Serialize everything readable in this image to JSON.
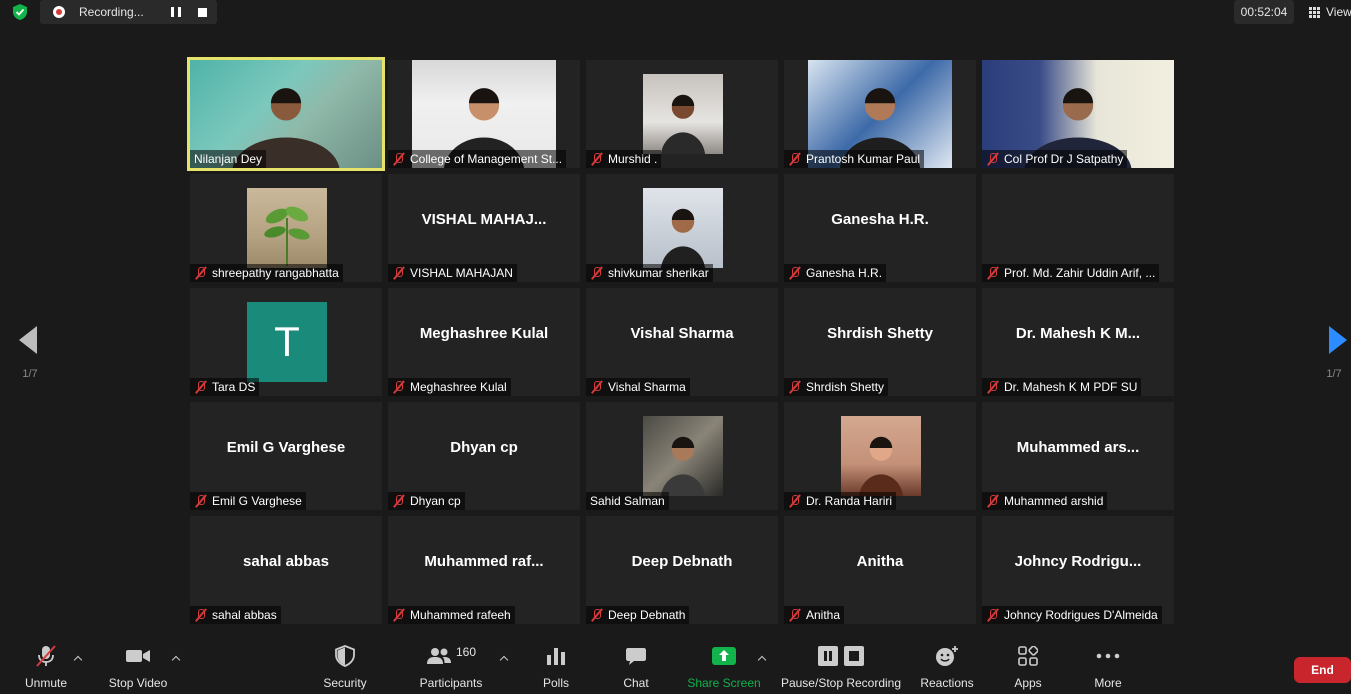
{
  "topbar": {
    "recording_label": "Recording...",
    "timer": "00:52:04",
    "view_label": "View"
  },
  "nav": {
    "left_page": "1/7",
    "right_page": "1/7"
  },
  "colors": {
    "accent": "#2d8cff",
    "active_speaker": "#e6e36a",
    "muted": "#d63b3b",
    "end": "#c9252d",
    "share": "#12b34b"
  },
  "tiles": [
    {
      "name": "Nilanjan Dey",
      "muted": false,
      "video": true
    },
    {
      "name": "College of Management St...",
      "muted": true,
      "video": true
    },
    {
      "name": "Murshid .",
      "muted": true,
      "video": true
    },
    {
      "name": "Prantosh Kumar Paul",
      "muted": true,
      "video": true
    },
    {
      "name": "Col Prof Dr J Satpathy",
      "muted": true,
      "video": true
    },
    {
      "name": "shreepathy rangabhatta",
      "muted": true,
      "video": true
    },
    {
      "name": "VISHAL MAHAJAN",
      "display": "VISHAL  MAHAJ...",
      "muted": true,
      "video": false
    },
    {
      "name": "shivkumar sherikar",
      "muted": true,
      "video": true
    },
    {
      "name": "Ganesha H.R.",
      "display": "Ganesha H.R.",
      "muted": true,
      "video": false
    },
    {
      "name": "Prof. Md. Zahir Uddin Arif, ...",
      "muted": true,
      "video": false
    },
    {
      "name": "Tara DS",
      "avatar_letter": "T",
      "muted": true,
      "video": false
    },
    {
      "name": "Meghashree Kulal",
      "display": "Meghashree Kulal",
      "muted": true,
      "video": false
    },
    {
      "name": "Vishal Sharma",
      "display": "Vishal Sharma",
      "muted": true,
      "video": false
    },
    {
      "name": "Shrdish Shetty",
      "display": "Shrdish Shetty",
      "muted": true,
      "video": false
    },
    {
      "name": "Dr. Mahesh K M PDF   SU",
      "display": "Dr. Mahesh K M...",
      "muted": true,
      "video": false
    },
    {
      "name": "Emil G Varghese",
      "display": "Emil G Varghese",
      "muted": true,
      "video": false
    },
    {
      "name": "Dhyan cp",
      "display": "Dhyan cp",
      "muted": true,
      "video": false
    },
    {
      "name": "Sahid Salman",
      "muted": false,
      "video": true
    },
    {
      "name": "Dr. Randa Hariri",
      "muted": true,
      "video": true
    },
    {
      "name": "Muhammed arshid",
      "display": "Muhammed  ars...",
      "muted": true,
      "video": false
    },
    {
      "name": "sahal abbas",
      "display": "sahal abbas",
      "muted": true,
      "video": false
    },
    {
      "name": "Muhammed rafeeh",
      "display": "Muhammed  raf...",
      "muted": true,
      "video": false
    },
    {
      "name": "Deep Debnath",
      "display": "Deep Debnath",
      "muted": true,
      "video": false
    },
    {
      "name": "Anitha",
      "display": "Anitha",
      "muted": true,
      "video": false
    },
    {
      "name": "Johncy Rodrigues D'Almeida",
      "display": "Johncy  Rodrigu...",
      "muted": true,
      "video": false
    }
  ],
  "toolbar": {
    "unmute": "Unmute",
    "stop_video": "Stop Video",
    "security": "Security",
    "participants": "Participants",
    "participants_count": "160",
    "polls": "Polls",
    "chat": "Chat",
    "share_screen": "Share Screen",
    "recording": "Pause/Stop Recording",
    "reactions": "Reactions",
    "apps": "Apps",
    "more": "More",
    "end": "End"
  }
}
